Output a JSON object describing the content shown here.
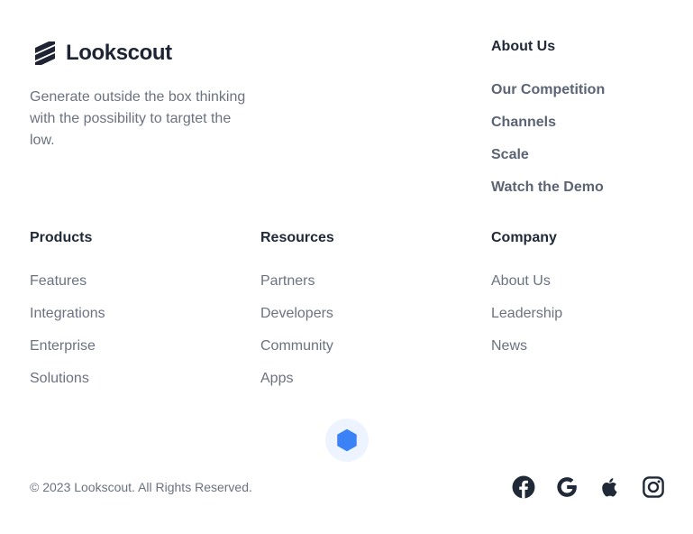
{
  "brand": {
    "name": "Lookscout",
    "tagline": "Generate outside the box thinking with the possibility to targtet the low."
  },
  "columns": {
    "about": {
      "heading": "About Us",
      "links": [
        "Our Competition",
        "Channels",
        "Scale",
        "Watch the Demo"
      ]
    },
    "products": {
      "heading": "Products",
      "links": [
        "Features",
        "Integrations",
        "Enterprise",
        "Solutions"
      ]
    },
    "resources": {
      "heading": "Resources",
      "links": [
        "Partners",
        "Developers",
        "Community",
        "Apps"
      ]
    },
    "company": {
      "heading": "Company",
      "links": [
        "About Us",
        "Leadership",
        "News"
      ]
    }
  },
  "divider": {
    "icon": "hexagon-icon",
    "color": "#3b82f6",
    "background": "#eef4ff"
  },
  "footer": {
    "copyright": "© 2023 Lookscout. All Rights Reserved."
  },
  "social": [
    {
      "icon": "facebook-icon"
    },
    {
      "icon": "google-icon"
    },
    {
      "icon": "apple-icon"
    },
    {
      "icon": "instagram-icon"
    }
  ],
  "colors": {
    "heading": "#1f2937",
    "text": "#6b7280",
    "brand": "#1e2433",
    "accent": "#3b82f6"
  }
}
